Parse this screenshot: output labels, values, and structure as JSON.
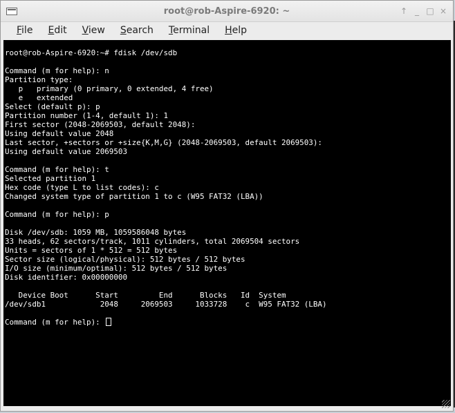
{
  "window": {
    "title": "root@rob-Aspire-6920: ~",
    "controls": {
      "up": "↑",
      "minimize": "_",
      "maximize": "□",
      "close": "×"
    }
  },
  "menu": {
    "file": "File",
    "edit": "Edit",
    "view": "View",
    "search": "Search",
    "terminal": "Terminal",
    "help": "Help"
  },
  "terminal": {
    "lines": [
      "root@rob-Aspire-6920:~# fdisk /dev/sdb",
      "",
      "Command (m for help): n",
      "Partition type:",
      "   p   primary (0 primary, 0 extended, 4 free)",
      "   e   extended",
      "Select (default p): p",
      "Partition number (1-4, default 1): 1",
      "First sector (2048-2069503, default 2048):",
      "Using default value 2048",
      "Last sector, +sectors or +size{K,M,G} (2048-2069503, default 2069503):",
      "Using default value 2069503",
      "",
      "Command (m for help): t",
      "Selected partition 1",
      "Hex code (type L to list codes): c",
      "Changed system type of partition 1 to c (W95 FAT32 (LBA))",
      "",
      "Command (m for help): p",
      "",
      "Disk /dev/sdb: 1059 MB, 1059586048 bytes",
      "33 heads, 62 sectors/track, 1011 cylinders, total 2069504 sectors",
      "Units = sectors of 1 * 512 = 512 bytes",
      "Sector size (logical/physical): 512 bytes / 512 bytes",
      "I/O size (minimum/optimal): 512 bytes / 512 bytes",
      "Disk identifier: 0x00000000",
      "",
      "   Device Boot      Start         End      Blocks   Id  System",
      "/dev/sdb1            2048     2069503     1033728    c  W95 FAT32 (LBA)",
      ""
    ],
    "prompt": "Command (m for help): "
  }
}
